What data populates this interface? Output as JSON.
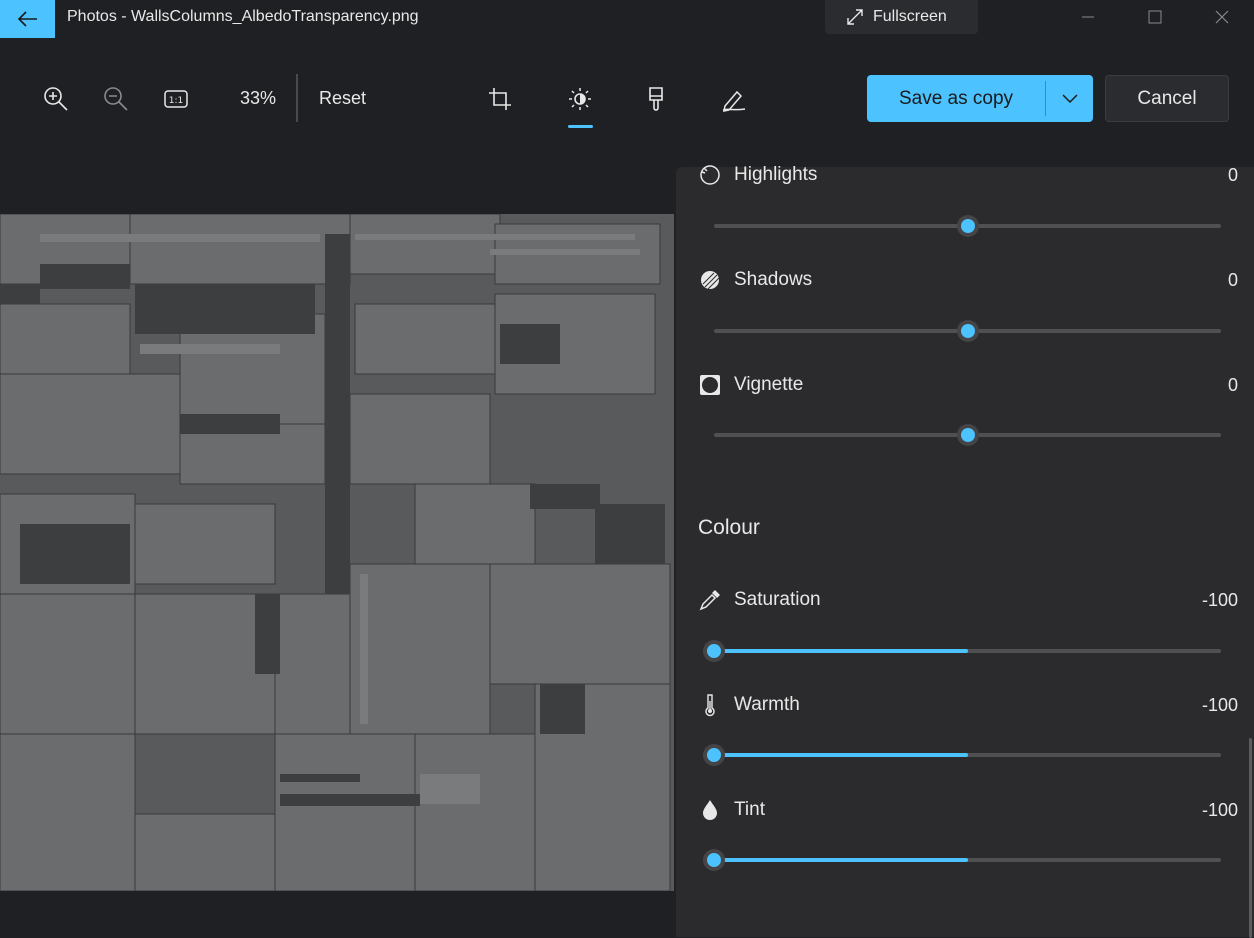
{
  "app": {
    "title": "Photos - WallsColumns_AlbedoTransparency.png",
    "fullscreen_label": "Fullscreen"
  },
  "toolbar": {
    "zoom_percent": "33%",
    "reset_label": "Reset",
    "save_label": "Save as copy",
    "cancel_label": "Cancel",
    "active_tab": "adjustment",
    "tabs": [
      "crop",
      "adjustment",
      "filter",
      "markup"
    ]
  },
  "adjustments": {
    "light": [
      {
        "label": "Highlights",
        "value": "0",
        "level": 0
      },
      {
        "label": "Shadows",
        "value": "0",
        "level": 0
      },
      {
        "label": "Vignette",
        "value": "0",
        "level": 0
      }
    ],
    "colour_section": "Colour",
    "colour": [
      {
        "label": "Saturation",
        "value": "-100",
        "level": -100
      },
      {
        "label": "Warmth",
        "value": "-100",
        "level": -100
      },
      {
        "label": "Tint",
        "value": "-100",
        "level": -100
      }
    ]
  },
  "colors": {
    "accent": "#4cc2ff",
    "background": "#1f2023",
    "panel": "#2b2b2d"
  }
}
